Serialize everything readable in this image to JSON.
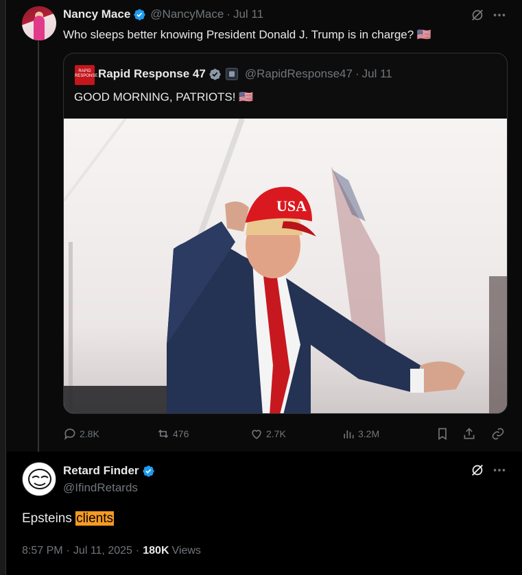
{
  "colors": {
    "accent": "#1d9bf0",
    "muted": "#71767b",
    "highlight": "#f59a23",
    "text": "#e7e9ea"
  },
  "parent_tweet": {
    "author_name": "Nancy Mace",
    "author_handle": "@NancyMace",
    "separator": "·",
    "date": "Jul 11",
    "text": "Who sleeps better knowing President Donald J. Trump is in charge? 🇺🇸",
    "quote": {
      "author_name": "Rapid Response 47",
      "author_handle": "@RapidResponse47",
      "separator": "·",
      "date": "Jul 11",
      "avatar_text": "RAPID RESPONSE",
      "text": "GOOD MORNING, PATRIOTS! 🇺🇸",
      "photo_cap_text": "USA"
    },
    "metrics": {
      "replies": "2.8K",
      "reposts": "476",
      "likes": "2.7K",
      "views": "3.2M"
    }
  },
  "reply_tweet": {
    "author_name": "Retard Finder",
    "author_handle": "@IfindRetards",
    "text_before": "Epsteins",
    "text_highlight": "clients",
    "time": "8:57 PM",
    "separator": "·",
    "date": "Jul 11, 2025",
    "separator2": "·",
    "views_count": "180K",
    "views_label": "Views"
  },
  "icons": [
    "grok-icon",
    "more-icon",
    "verified-icon",
    "reply-icon",
    "repost-icon",
    "like-icon",
    "views-icon",
    "bookmark-icon",
    "share-icon",
    "link-icon",
    "government-badge-icon"
  ]
}
